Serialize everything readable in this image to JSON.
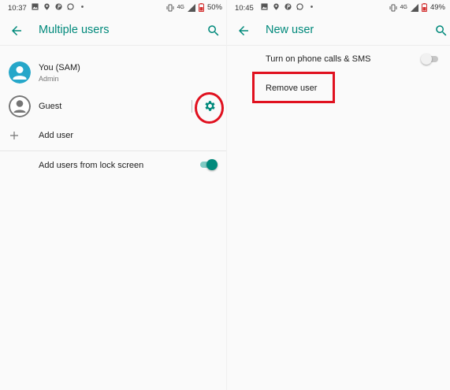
{
  "left_screen": {
    "status": {
      "time": "10:37",
      "battery": "50%",
      "network": "4G"
    },
    "appbar": {
      "title": "Multiple users"
    },
    "users": [
      {
        "name": "You (SAM)",
        "subtitle": "Admin"
      },
      {
        "name": "Guest"
      }
    ],
    "add_user_label": "Add user",
    "lock_screen_label": "Add users from lock screen",
    "lock_screen_toggle_on": true
  },
  "right_screen": {
    "status": {
      "time": "10:45",
      "battery": "49%",
      "network": "4G"
    },
    "appbar": {
      "title": "New user"
    },
    "phone_calls_label": "Turn on phone calls & SMS",
    "phone_calls_toggle_on": false,
    "remove_user_label": "Remove user"
  },
  "icons": [
    "back-arrow-icon",
    "search-icon",
    "person-icon",
    "gear-icon",
    "plus-icon"
  ],
  "colors": {
    "accent": "#00897b",
    "annotation": "#e0111f",
    "admin_avatar": "#26a7c9",
    "guest_avatar": "#757575"
  }
}
